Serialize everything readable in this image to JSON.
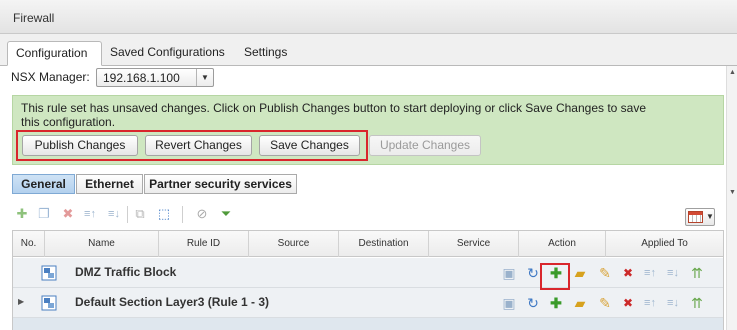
{
  "window": {
    "title": "Firewall"
  },
  "tabs": [
    {
      "label": "Configuration",
      "active": true
    },
    {
      "label": "Saved Configurations",
      "active": false
    },
    {
      "label": "Settings",
      "active": false
    }
  ],
  "nsx": {
    "label": "NSX Manager:",
    "value": "192.168.1.100"
  },
  "banner": {
    "message": "This rule set has unsaved changes. Click on Publish Changes button to start deploying or click Save Changes to save this configuration.",
    "buttons": {
      "publish": "Publish Changes",
      "revert": "Revert Changes",
      "save": "Save Changes",
      "update": "Update Changes"
    }
  },
  "subtabs": [
    {
      "label": "General",
      "active": true
    },
    {
      "label": "Ethernet",
      "active": false
    },
    {
      "label": "Partner security services",
      "active": false
    }
  ],
  "toolbar_icons": [
    "add-rule-icon",
    "copy-rule-icon",
    "delete-rule-icon",
    "move-rule-up-icon",
    "move-rule-down-icon",
    "paste-rule-icon",
    "apply-to-icon",
    "clear-filter-icon",
    "filter-icon",
    "column-chooser-icon"
  ],
  "table": {
    "headers": [
      "No.",
      "Name",
      "Rule ID",
      "Source",
      "Destination",
      "Service",
      "Action",
      "Applied To"
    ],
    "sections": [
      {
        "name": "DMZ Traffic Block",
        "expander": ""
      },
      {
        "name": "Default Section Layer3 (Rule 1 - 3)",
        "expander": "▶"
      }
    ]
  },
  "colors": {
    "banner_bg": "#cfe7c1",
    "highlight": "#d9262c",
    "active_subtab": "#b3d1ee",
    "add_green": "#3a9b2a",
    "delete_red": "#cc2a2a"
  }
}
